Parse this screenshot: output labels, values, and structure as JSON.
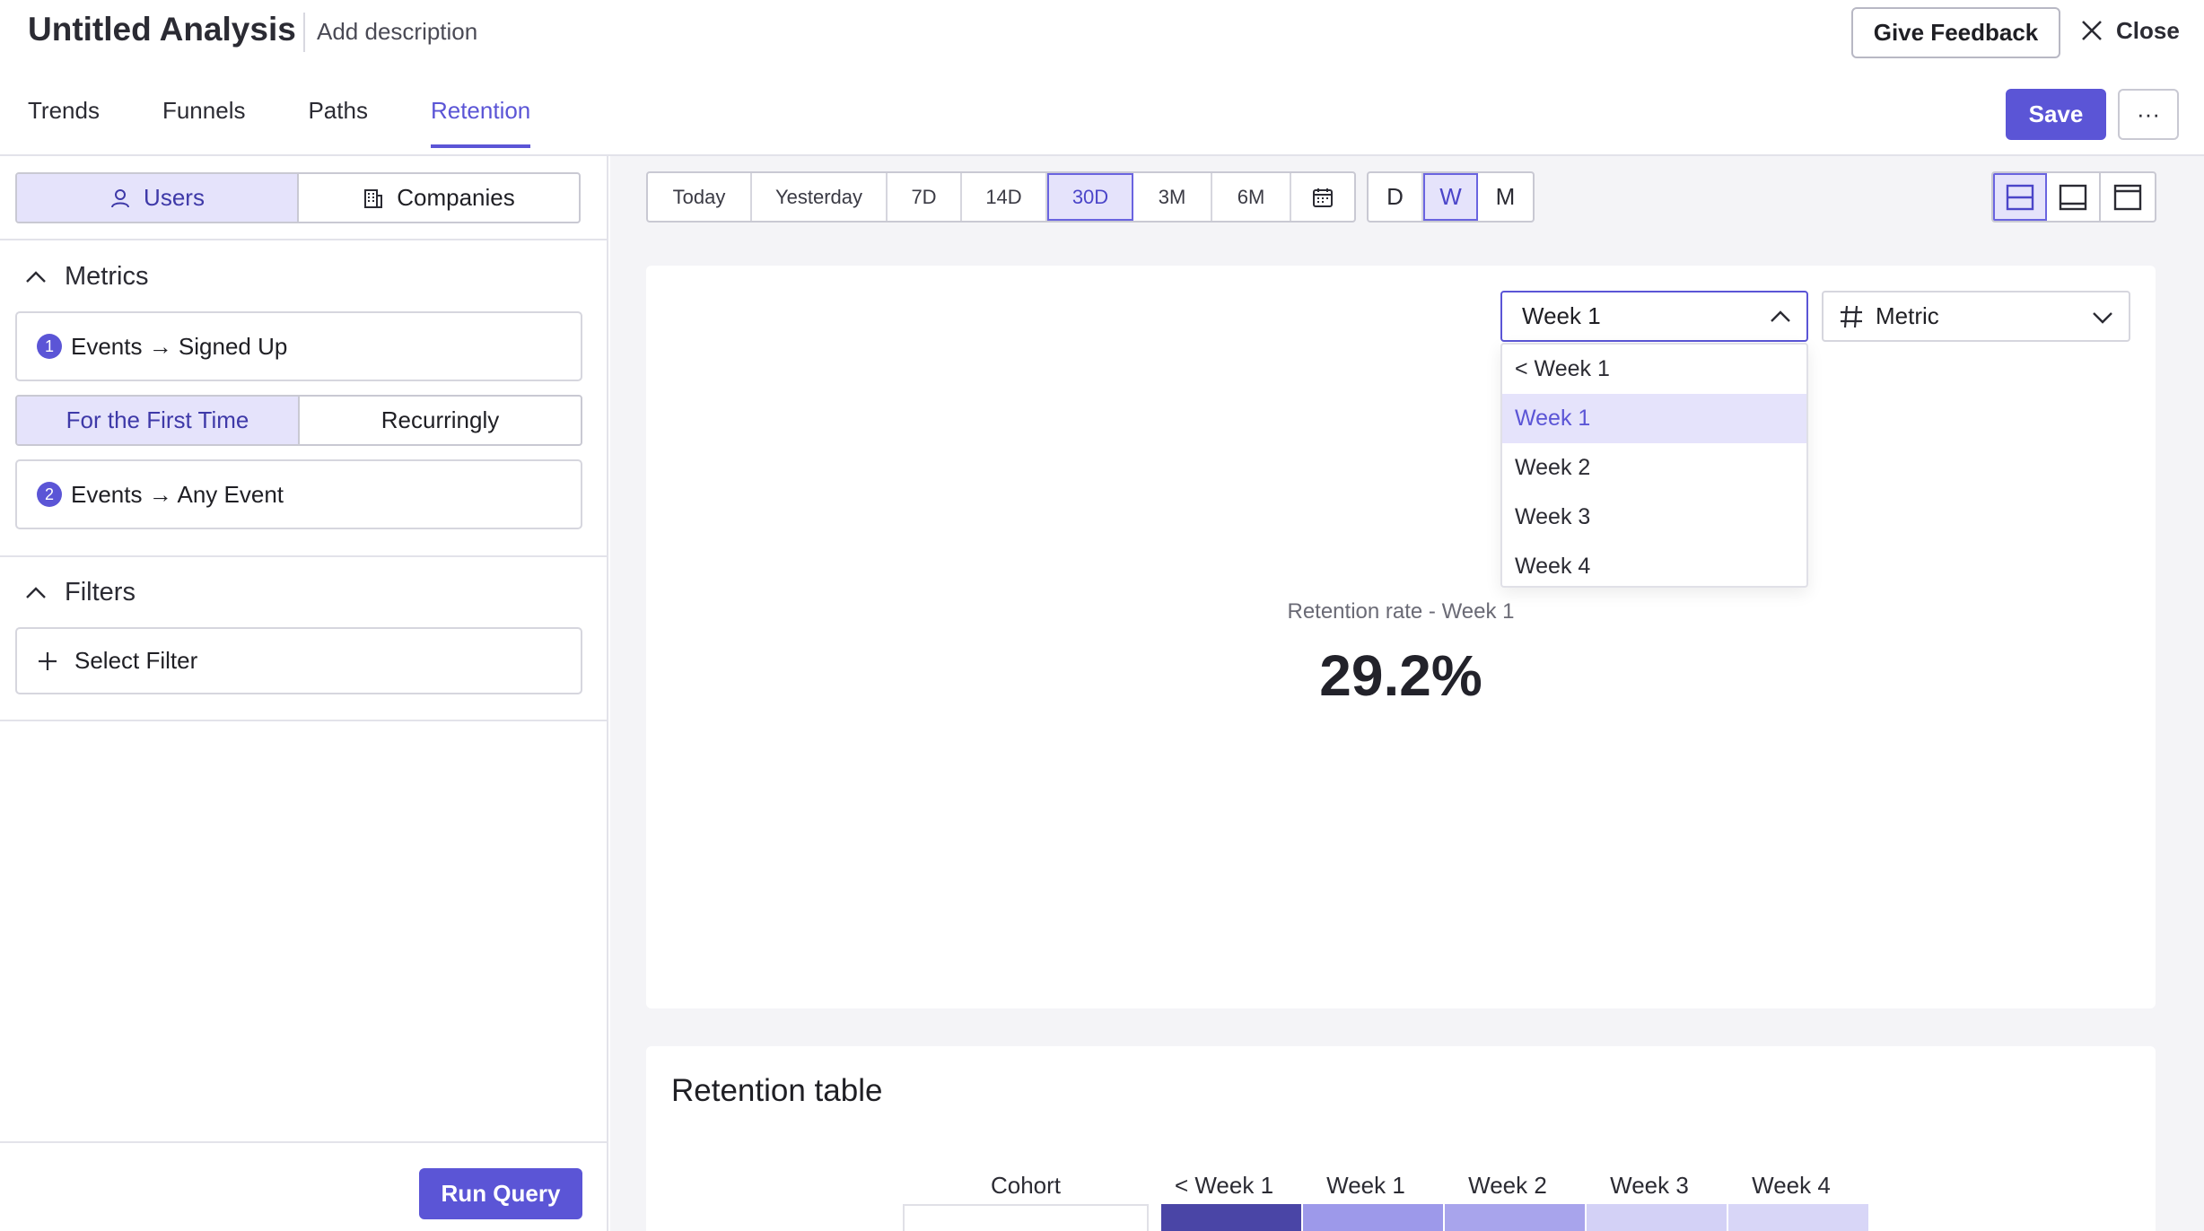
{
  "header": {
    "title": "Untitled Analysis",
    "description": "Add description",
    "feedback_label": "Give Feedback",
    "close_label": "Close",
    "save_label": "Save",
    "more_label": "···",
    "tabs": [
      {
        "label": "Trends"
      },
      {
        "label": "Funnels"
      },
      {
        "label": "Paths"
      },
      {
        "label": "Retention"
      }
    ]
  },
  "left": {
    "entity": {
      "users": "Users",
      "companies": "Companies"
    },
    "metrics_title": "Metrics",
    "metric1": {
      "num": "1",
      "label": "Events → Signed Up"
    },
    "frequency": {
      "first": "For the First Time",
      "recurring": "Recurringly"
    },
    "metric2": {
      "num": "2",
      "label": "Events → Any Event"
    },
    "filters_title": "Filters",
    "filter_label": "Select Filter",
    "run_label": "Run Query"
  },
  "toolbar": {
    "ranges": [
      {
        "label": "Today"
      },
      {
        "label": "Yesterday"
      },
      {
        "label": "7D"
      },
      {
        "label": "14D"
      },
      {
        "label": "30D"
      },
      {
        "label": "3M"
      },
      {
        "label": "6M"
      }
    ],
    "selected_range": "30D",
    "granularity": [
      {
        "label": "D"
      },
      {
        "label": "W"
      },
      {
        "label": "M"
      }
    ],
    "selected_granularity": "W"
  },
  "chart": {
    "week_select": "Week 1",
    "metric_select": "Metric",
    "dropdown": [
      {
        "label": "< Week 1"
      },
      {
        "label": "Week 1"
      },
      {
        "label": "Week 2"
      },
      {
        "label": "Week 3"
      },
      {
        "label": "Week 4"
      }
    ],
    "rate_label": "Retention rate - Week 1",
    "rate_value": "29.2%"
  },
  "table": {
    "title": "Retention table",
    "columns": [
      {
        "label": "Cohort"
      },
      {
        "label": "< Week 1"
      },
      {
        "label": "Week 1"
      },
      {
        "label": "Week 2"
      },
      {
        "label": "Week 3"
      },
      {
        "label": "Week 4"
      }
    ]
  },
  "colors": {
    "accent": "#5b55d6",
    "selected_bg": "#e5e3fb",
    "cell_1": "#4a45a6",
    "cell_2": "#9d99ea",
    "cell_3": "#a8a4ec",
    "cell_4": "#d3d1f6",
    "cell_5": "#d8d6f7"
  }
}
